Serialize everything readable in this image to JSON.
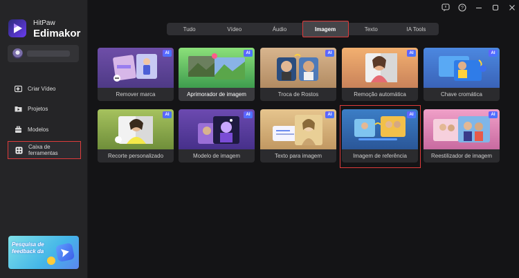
{
  "brand": {
    "line1": "HitPaw",
    "line2": "Edimakor"
  },
  "sidebar": {
    "items": [
      {
        "label": "Criar Vídeo",
        "icon": "create-video-icon"
      },
      {
        "label": "Projetos",
        "icon": "projects-icon"
      },
      {
        "label": "Modelos",
        "icon": "templates-icon"
      },
      {
        "label": "Caixa de ferramentas",
        "icon": "toolbox-icon",
        "active": true
      }
    ],
    "promo": "Pesquisa de feedback da"
  },
  "tabs": [
    {
      "label": "Tudo"
    },
    {
      "label": "Vídeo"
    },
    {
      "label": "Áudio"
    },
    {
      "label": "Imagem",
      "active": true
    },
    {
      "label": "Texto"
    },
    {
      "label": "IA Tools"
    }
  ],
  "badge_label": "AI",
  "cards": [
    {
      "label": "Remover marca",
      "icon": "watermark-remover-icon"
    },
    {
      "label": "Aprimorador de imagem",
      "icon": "image-enhancer-icon"
    },
    {
      "label": "Troca de Rostos",
      "icon": "face-swap-icon"
    },
    {
      "label": "Remoção automática",
      "icon": "auto-remove-icon"
    },
    {
      "label": "Chave cromática",
      "icon": "chroma-key-icon"
    },
    {
      "label": "Recorte personalizado",
      "icon": "custom-cutout-icon"
    },
    {
      "label": "Modelo de imagem",
      "icon": "image-template-icon"
    },
    {
      "label": "Texto para imagem",
      "icon": "text-to-image-icon"
    },
    {
      "label": "Imagem de referência",
      "icon": "reference-image-icon"
    },
    {
      "label": "Reestilizador de imagem",
      "icon": "image-restyler-icon"
    }
  ],
  "colors": {
    "accent": "#e03b3b",
    "badge": "#5a5cff",
    "background": "#141416",
    "sidebar": "#252527"
  }
}
